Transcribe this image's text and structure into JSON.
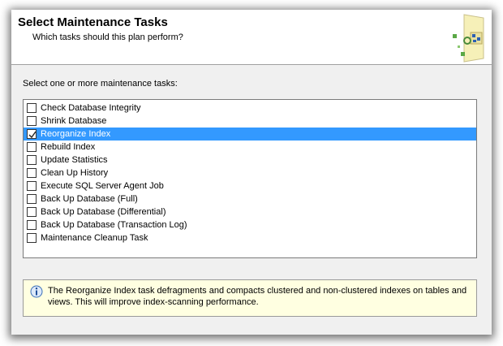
{
  "header": {
    "title": "Select Maintenance Tasks",
    "subtitle": "Which tasks should this plan perform?",
    "icon": "wizard-graphic-icon"
  },
  "instruction": "Select one or more maintenance tasks:",
  "tasks": [
    {
      "label": "Check Database Integrity",
      "checked": false,
      "selected": false
    },
    {
      "label": "Shrink Database",
      "checked": false,
      "selected": false
    },
    {
      "label": "Reorganize Index",
      "checked": true,
      "selected": true
    },
    {
      "label": "Rebuild Index",
      "checked": false,
      "selected": false
    },
    {
      "label": "Update Statistics",
      "checked": false,
      "selected": false
    },
    {
      "label": "Clean Up History",
      "checked": false,
      "selected": false
    },
    {
      "label": "Execute SQL Server Agent Job",
      "checked": false,
      "selected": false
    },
    {
      "label": "Back Up Database (Full)",
      "checked": false,
      "selected": false
    },
    {
      "label": "Back Up Database (Differential)",
      "checked": false,
      "selected": false
    },
    {
      "label": "Back Up Database (Transaction Log)",
      "checked": false,
      "selected": false
    },
    {
      "label": "Maintenance Cleanup Task",
      "checked": false,
      "selected": false
    }
  ],
  "info": {
    "icon": "info-icon",
    "text": "The Reorganize Index task defragments and compacts clustered and non-clustered indexes on tables and views. This will improve index-scanning performance."
  },
  "colors": {
    "selection": "#3399ff",
    "info_background": "#ffffe1"
  }
}
